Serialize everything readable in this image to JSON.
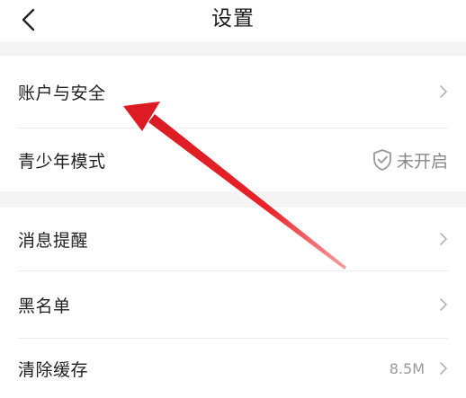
{
  "header": {
    "title": "设置"
  },
  "sections": [
    {
      "items": [
        {
          "label": "账户与安全",
          "value": ""
        },
        {
          "label": "青少年模式",
          "value": "未开启"
        }
      ]
    },
    {
      "items": [
        {
          "label": "消息提醒",
          "value": ""
        },
        {
          "label": "黑名单",
          "value": ""
        },
        {
          "label": "清除缓存",
          "value": "8.5M"
        }
      ]
    }
  ],
  "icons": {
    "back": "chevron-left-icon",
    "chevron": "chevron-right-icon",
    "shield": "shield-check-icon",
    "annotation": "red-arrow-annotation"
  },
  "colors": {
    "background": "#ffffff",
    "section_gap": "#f4f4f4",
    "divider": "#ececec",
    "text_primary": "#1f1f1f",
    "text_secondary": "#9a9a9a",
    "annotation_red": "#e8232a"
  }
}
